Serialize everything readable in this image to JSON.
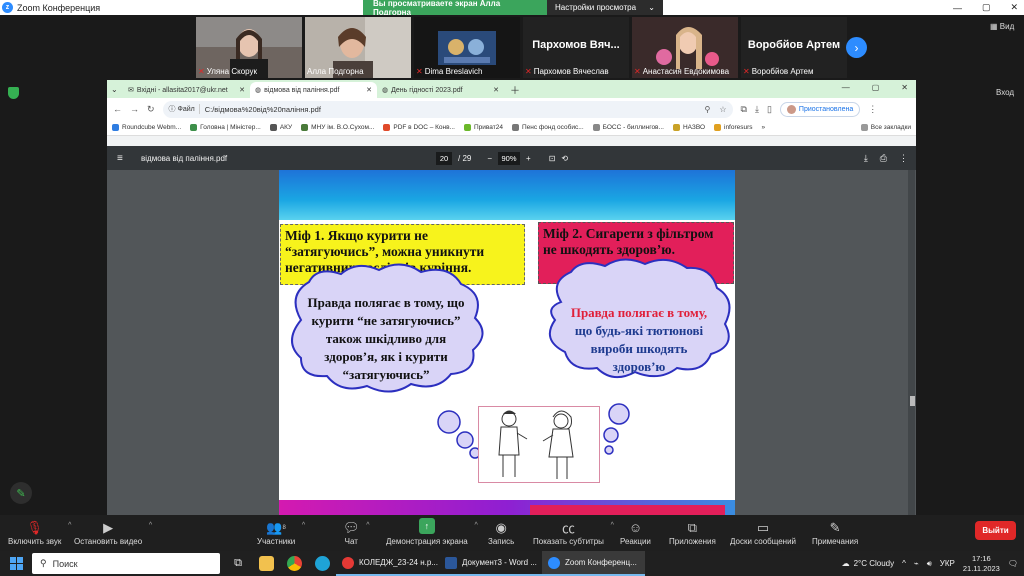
{
  "zoom": {
    "window_title": "Zoom Конференция",
    "share_banner": "Вы просматриваете экран Алла Подгорна",
    "view_options": "Настройки просмотра",
    "view_label": "Вид",
    "enter_label": "Вход",
    "participants": [
      {
        "name": "Уляна Скорук",
        "muted": true,
        "video": true
      },
      {
        "name": "Алла Подгорна",
        "muted": false,
        "video": true
      },
      {
        "name": "Dima Breslavich",
        "muted": true,
        "video": true
      },
      {
        "name": "Пархомов Вячеслав",
        "display": "Пархомов Вяч...",
        "muted": true,
        "video": false
      },
      {
        "name": "Анастасия Евдокимова",
        "muted": true,
        "video": true
      },
      {
        "name": "Воробйов Артем",
        "display": "Воробйов Артем",
        "muted": true,
        "video": false
      }
    ],
    "controls": {
      "unmute": "Включить звук",
      "stop_video": "Остановить видео",
      "participants": "Участники",
      "participants_count": "8",
      "chat": "Чат",
      "share": "Демонстрация экрана",
      "record": "Запись",
      "captions": "Показать субтитры",
      "reactions": "Реакции",
      "apps": "Приложения",
      "whiteboard": "Доски сообщений",
      "notes": "Примечания",
      "leave": "Выйти"
    }
  },
  "browser": {
    "tabs": [
      {
        "title": "Вхідні - allasita2017@ukr.net",
        "active": false
      },
      {
        "title": "відмова від паління.pdf",
        "active": true
      },
      {
        "title": "День гідності 2023.pdf",
        "active": false
      }
    ],
    "address_prefix": "Файл",
    "address": "C:/відмова%20від%20паління.pdf",
    "profile": "Приостановлена",
    "bookmarks": [
      "Roundcube Webm...",
      "Головна | Міністер...",
      "АКУ",
      "МНУ ім. В.О.Сухом...",
      "PDF в DOC – Конв...",
      "Приват24",
      "Пенс фонд особис...",
      "БОСС - биллингов...",
      "НАЗВО",
      "inforesurs"
    ],
    "all_bookmarks": "Все закладки"
  },
  "pdf": {
    "filename": "відмова від паління.pdf",
    "page_current": "20",
    "page_total": "/ 29",
    "zoom": "90%"
  },
  "slide": {
    "myth1": "Міф 1. Якщо курити не “затягуючись”, можна уникнути негативних наслідків куріння.",
    "myth2": "Міф 2. Сигарети з фільтром не шкодять здоров’ю.",
    "truth1": "Правда полягає в тому, що курити “не затягуючись” також шкідливо для здоров’я, як і курити “затягуючись”",
    "truth2_red": "Правда полягає в тому,",
    "truth2_blue": " що будь-які тютюнові вироби шкодять здоров’ю"
  },
  "taskbar": {
    "search": "Поиск",
    "windows": [
      {
        "title": "КОЛЕДЖ_23-24 н.р...",
        "color": "#e53935"
      },
      {
        "title": "Документ3 - Word ...",
        "color": "#2b579a"
      },
      {
        "title": "Zoom Конференц...",
        "color": "#2d8cff"
      }
    ],
    "weather": "2°C  Cloudy",
    "lang": "УКР",
    "time": "17:16",
    "date": "21.11.2023"
  }
}
